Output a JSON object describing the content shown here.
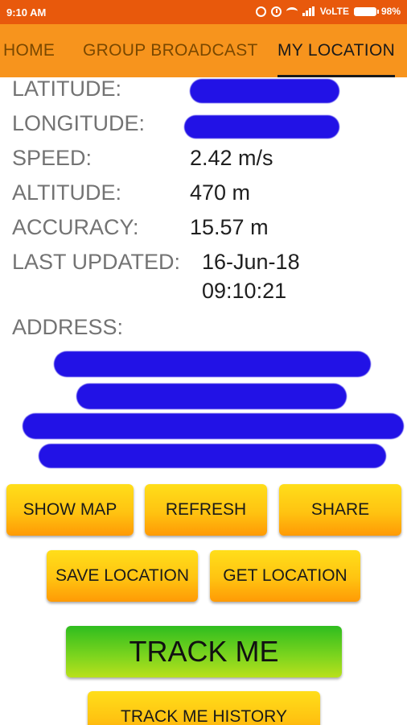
{
  "status_bar": {
    "time": "9:10 AM",
    "network": "VoLTE",
    "battery": "98%"
  },
  "tabs": [
    {
      "label": "HOME"
    },
    {
      "label": "GROUP BROADCAST"
    },
    {
      "label": "MY LOCATION"
    }
  ],
  "info": {
    "latitude_label": "LATITUDE:",
    "longitude_label": "LONGITUDE:",
    "speed_label": "SPEED:",
    "speed_value": "2.42 m/s",
    "altitude_label": "ALTITUDE:",
    "altitude_value": "470 m",
    "accuracy_label": "ACCURACY:",
    "accuracy_value": "15.57 m",
    "updated_label": "LAST UPDATED:",
    "updated_date": "16-Jun-18",
    "updated_time": "09:10:21",
    "address_label": "ADDRESS:"
  },
  "buttons": {
    "show_map": "SHOW MAP",
    "refresh": "REFRESH",
    "share": "SHARE",
    "save_location": "SAVE LOCATION",
    "get_location": "GET LOCATION",
    "track_me": "TRACK ME",
    "track_history": "TRACK ME HISTORY"
  },
  "colors": {
    "status_bar": "#e8590c",
    "tab_bar": "#f7941d",
    "redaction": "#2212e6",
    "button_yellow": "#ffc311",
    "button_green": "#7fd51e"
  }
}
